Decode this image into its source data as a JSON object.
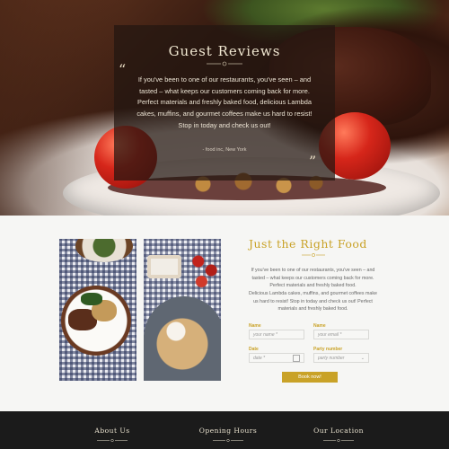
{
  "hero": {
    "title": "Guest Reviews",
    "review": "If you've been to one of our restaurants, you've seen – and tasted – what keeps our customers coming back for more. Perfect materials and freshly baked food, delicious Lambda cakes, muffins, and gourmet coffees make us hard to resist! Stop in today and check us out!",
    "source": "- food inc, New York",
    "quote_open": "“",
    "quote_close": "”"
  },
  "section": {
    "title": "Just the Right Food",
    "paragraph1": "If you've been to one of our restaurants, you've seen – and tasted – what keeps our customers coming back for more. Perfect materials and freshly baked food.",
    "paragraph2": "Delicious Lambda cakes, muffins, and gourmet coffees make us hard to resist! Stop in today and check us out! Perfect materials and freshly baked food."
  },
  "form": {
    "name_label": "Name",
    "name_placeholder": "your name *",
    "email_label": "Name",
    "email_placeholder": "your email *",
    "date_label": "Date",
    "date_placeholder": "date *",
    "party_label": "Party number",
    "party_placeholder": "party number",
    "submit": "Book now!"
  },
  "footer": {
    "about": "About Us",
    "hours": "Opening Hours",
    "location": "Our Location"
  },
  "colors": {
    "accent": "#c9a227",
    "footer_bg": "#1b1b1b"
  }
}
